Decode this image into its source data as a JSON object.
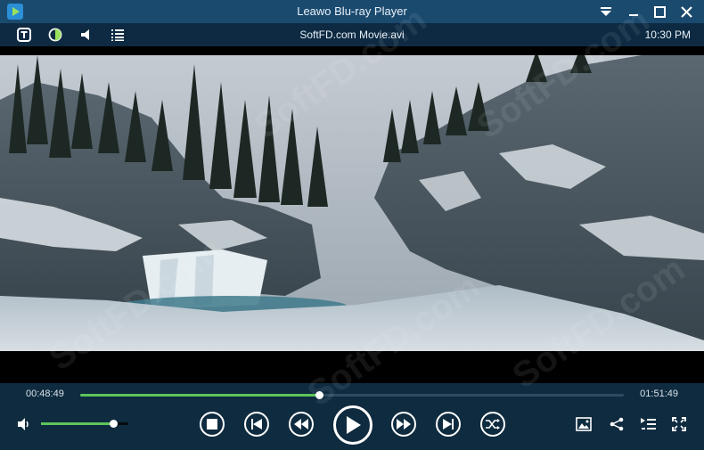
{
  "window": {
    "title": "Leawo Blu-ray Player",
    "accent": "#1b4a6f"
  },
  "toolbar": {
    "filename": "SoftFD.com Movie.avi",
    "clock": "10:30 PM",
    "icons": [
      "subtitle-icon",
      "brightness-icon",
      "audio-icon",
      "playlist-icon"
    ]
  },
  "player": {
    "elapsed": "00:48:49",
    "duration": "01:51:49",
    "progress": 0.44,
    "volume": 0.83,
    "progress_color": "#5cc55a"
  },
  "watermark": "SoftFD.com"
}
